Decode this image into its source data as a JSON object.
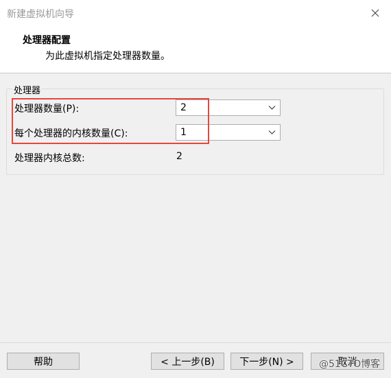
{
  "window": {
    "title": "新建虚拟机向导"
  },
  "header": {
    "title": "处理器配置",
    "subtitle": "为此虚拟机指定处理器数量。"
  },
  "processor": {
    "group_label": "处理器",
    "count_label": "处理器数量(P):",
    "count_value": "2",
    "cores_label": "每个处理器的内核数量(C):",
    "cores_value": "1",
    "total_label": "处理器内核总数:",
    "total_value": "2"
  },
  "buttons": {
    "help": "帮助",
    "back": "< 上一步(B)",
    "next": "下一步(N) >",
    "cancel": "取消"
  },
  "watermark": "@51CTO博客",
  "colors": {
    "highlight": "#e8453c",
    "window_bg": "#f0f0f0"
  }
}
